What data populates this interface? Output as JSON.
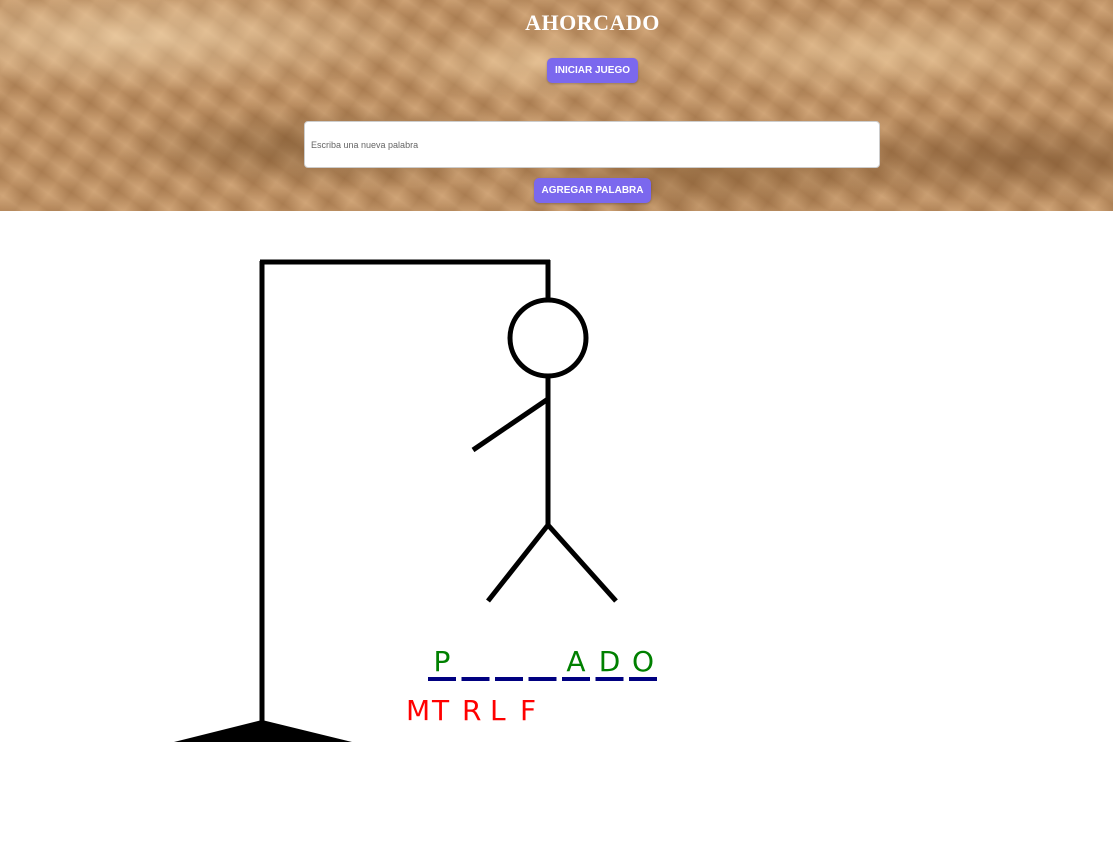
{
  "header": {
    "title": "AHORCADO",
    "start_button_label": "INICIAR JUEGO",
    "new_word_placeholder": "Escriba una nueva palabra",
    "add_word_button_label": "AGREGAR PALABRA"
  },
  "game": {
    "word_slots": [
      "P",
      "",
      "",
      "",
      "A",
      "D",
      "O"
    ],
    "wrong_letters": [
      "M",
      "T",
      "R",
      "L",
      "F"
    ],
    "colors": {
      "correct_letter": "#008000",
      "wrong_letter": "#ff0000",
      "underline": "#000080",
      "gallows": "#000000",
      "button": "#7b68ee"
    }
  }
}
